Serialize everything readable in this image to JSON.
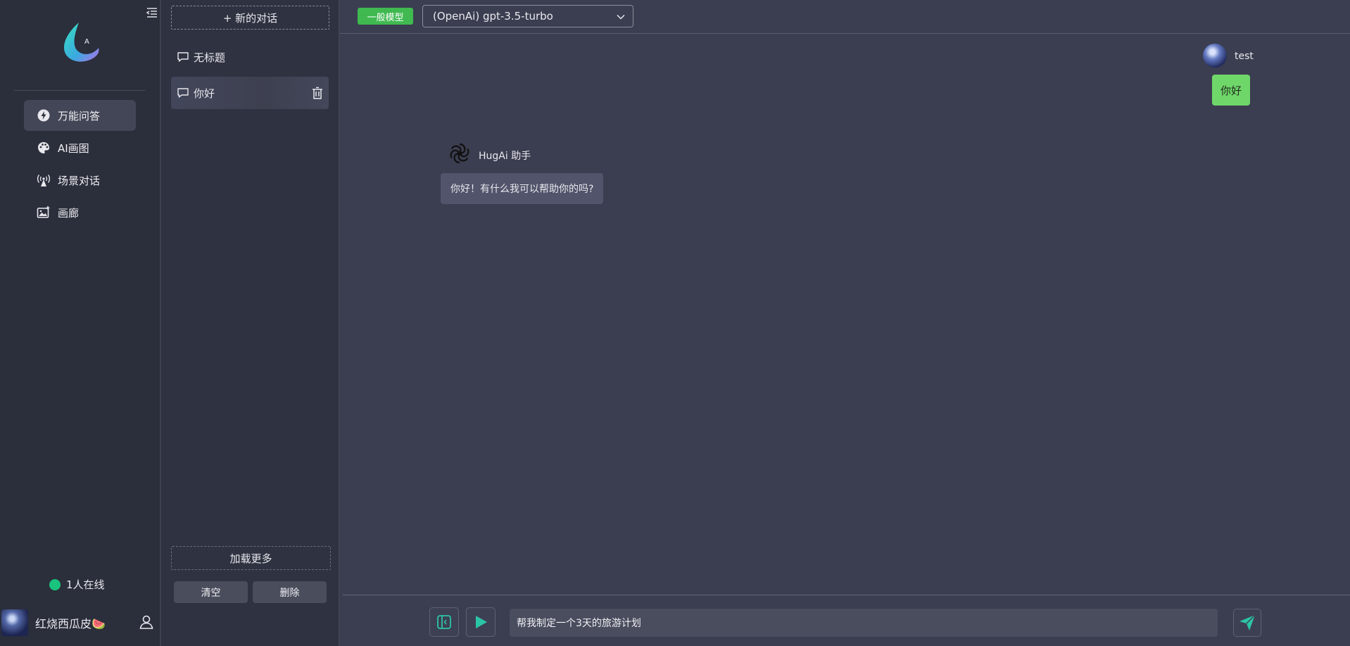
{
  "nav": {
    "items": [
      {
        "label": "万能问答",
        "icon": "flash-chat-icon",
        "active": true
      },
      {
        "label": "AI画图",
        "icon": "palette-icon",
        "active": false
      },
      {
        "label": "场景对话",
        "icon": "broadcast-tower-icon",
        "active": false
      },
      {
        "label": "画廊",
        "icon": "gallery-icon",
        "active": false
      }
    ],
    "online_text": "1人在线",
    "user_name": "红烧西瓜皮🍉"
  },
  "conversations": {
    "new_chat_label": "+ 新的对话",
    "items": [
      {
        "title": "无标题",
        "active": false
      },
      {
        "title": "你好",
        "active": true
      }
    ],
    "load_more_label": "加载更多",
    "clear_label": "清空",
    "delete_label": "删除"
  },
  "topbar": {
    "model_badge": "一般模型",
    "model_selected": "(OpenAi) gpt-3.5-turbo"
  },
  "chat": {
    "user_name": "test",
    "user_message": "你好",
    "bot_name": "HugAi 助手",
    "bot_message": "你好！有什么我可以帮助你的吗?"
  },
  "input": {
    "value": "帮我制定一个3天的旅游计划"
  },
  "colors": {
    "accent_green": "#3fb950",
    "user_bubble": "#6fd76a",
    "online": "#19c37d",
    "teal_icon": "#2bc4a6"
  }
}
